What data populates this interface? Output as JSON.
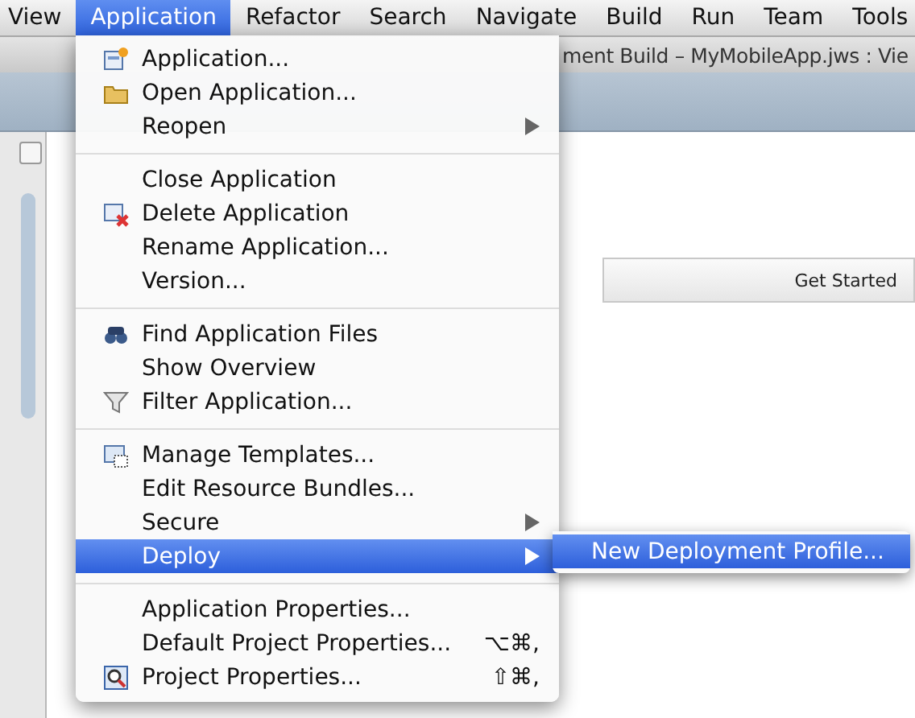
{
  "menubar": [
    {
      "label": "View",
      "selected": false
    },
    {
      "label": "Application",
      "selected": true
    },
    {
      "label": "Refactor",
      "selected": false
    },
    {
      "label": "Search",
      "selected": false
    },
    {
      "label": "Navigate",
      "selected": false
    },
    {
      "label": "Build",
      "selected": false
    },
    {
      "label": "Run",
      "selected": false
    },
    {
      "label": "Team",
      "selected": false
    },
    {
      "label": "Tools",
      "selected": false
    }
  ],
  "window": {
    "title": "ment Build – MyMobileApp.jws : Vie"
  },
  "editor": {
    "tab": "Get Started"
  },
  "menu": {
    "sections": [
      {
        "items": [
          {
            "label": "Application...",
            "selected": false,
            "has_submenu": false
          },
          {
            "label": "Open Application...",
            "selected": false,
            "has_submenu": false
          },
          {
            "label": "Reopen",
            "selected": false,
            "has_submenu": true
          }
        ]
      },
      {
        "items": [
          {
            "label": "Close Application",
            "selected": false,
            "has_submenu": false
          },
          {
            "label": "Delete Application",
            "selected": false,
            "has_submenu": false
          },
          {
            "label": "Rename Application...",
            "selected": false,
            "has_submenu": false
          },
          {
            "label": "Version...",
            "selected": false,
            "has_submenu": false
          }
        ]
      },
      {
        "items": [
          {
            "label": "Find Application Files",
            "selected": false,
            "has_submenu": false
          },
          {
            "label": "Show Overview",
            "selected": false,
            "has_submenu": false
          },
          {
            "label": "Filter Application...",
            "selected": false,
            "has_submenu": false
          }
        ]
      },
      {
        "items": [
          {
            "label": "Manage Templates...",
            "selected": false,
            "has_submenu": false
          },
          {
            "label": "Edit Resource Bundles...",
            "selected": false,
            "has_submenu": false
          },
          {
            "label": "Secure",
            "selected": false,
            "has_submenu": true
          },
          {
            "label": "Deploy",
            "selected": true,
            "has_submenu": true
          }
        ]
      },
      {
        "items": [
          {
            "label": "Application Properties...",
            "selected": false,
            "has_submenu": false
          },
          {
            "label": "Default Project Properties...",
            "selected": false,
            "has_submenu": false,
            "shortcut": "⌥⌘,"
          },
          {
            "label": "Project Properties...",
            "selected": false,
            "has_submenu": false,
            "shortcut": "⇧⌘,"
          }
        ]
      }
    ]
  },
  "submenu": {
    "items": [
      {
        "label": "New Deployment Profile...",
        "selected": true
      }
    ]
  }
}
